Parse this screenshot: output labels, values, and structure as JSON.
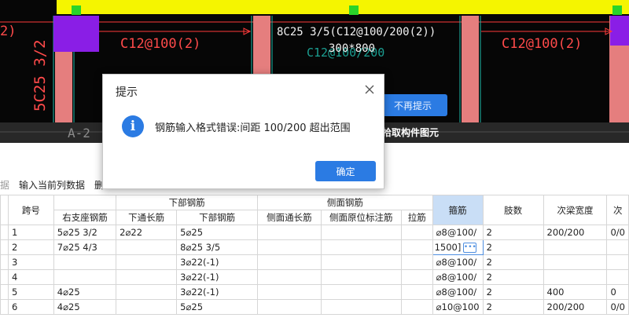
{
  "cad": {
    "beam_label_line1": "8C25 3/5(C12@100/200(2))",
    "beam_label_line2": "300*800",
    "stirrup_left": "C12@100(2)",
    "stirrup_right": "C12@100(2)",
    "stirrup_center_ghost": "C12@100/200",
    "left_edge_text": "2)",
    "vertical_rebar": "5C25 3/2",
    "axis_label": "A-2",
    "status_text": "拾取构件图元",
    "no_remind_button": "不再提示",
    "colors": {
      "beam_yellow": "#f5f500",
      "column_pink": "#e88080",
      "violet": "#8a1ee6",
      "grip_green": "#2ad42a"
    }
  },
  "toolbar": {
    "faded_item": "据",
    "input_column": "输入当前列数据",
    "delete_item": "删"
  },
  "dialog": {
    "title": "提示",
    "message": "钢筋输入格式错误:间距 100/200 超出范围",
    "ok_label": "确定",
    "info_icon": "info-icon",
    "close_icon": "close-icon"
  },
  "table": {
    "group_headers": {
      "span": "跨号",
      "bottom": "下部钢筋",
      "side": "侧面钢筋",
      "stirrup": "箍筋",
      "legs": "肢数",
      "secondary_width": "次梁宽度",
      "overflow": "次"
    },
    "sub_headers": {
      "right_support": "右支座钢筋",
      "bottom_through": "下通长筋",
      "bottom_rebar": "下部钢筋",
      "side_through": "侧面通长筋",
      "side_original": "侧面原位标注筋",
      "tie": "拉筋"
    },
    "rows": [
      {
        "span": "1",
        "right_support": "5⌀25 3/2",
        "bottom_through": "2⌀22",
        "bottom_rebar": "5⌀25",
        "side_through": "",
        "side_original": "",
        "tie": "",
        "stirrup": "⌀8@100/",
        "legs": "2",
        "secondary_width": "200/200",
        "overflow": "0/0"
      },
      {
        "span": "2",
        "right_support": "7⌀25 4/3",
        "bottom_through": "",
        "bottom_rebar": "8⌀25 3/5",
        "side_through": "",
        "side_original": "",
        "tie": "",
        "stirrup": "1500]",
        "legs": "2",
        "secondary_width": "",
        "overflow": ""
      },
      {
        "span": "3",
        "right_support": "",
        "bottom_through": "",
        "bottom_rebar": "3⌀22(-1)",
        "side_through": "",
        "side_original": "",
        "tie": "",
        "stirrup": "⌀8@100/",
        "legs": "2",
        "secondary_width": "",
        "overflow": ""
      },
      {
        "span": "4",
        "right_support": "",
        "bottom_through": "",
        "bottom_rebar": "3⌀22(-1)",
        "side_through": "",
        "side_original": "",
        "tie": "",
        "stirrup": "⌀8@100/",
        "legs": "2",
        "secondary_width": "",
        "overflow": ""
      },
      {
        "span": "5",
        "right_support": "4⌀25",
        "bottom_through": "",
        "bottom_rebar": "3⌀22(-1)",
        "side_through": "",
        "side_original": "",
        "tie": "",
        "stirrup": "⌀8@100/",
        "legs": "2",
        "secondary_width": "400",
        "overflow": "0"
      },
      {
        "span": "6",
        "right_support": "4⌀25",
        "bottom_through": "",
        "bottom_rebar": "5⌀25",
        "side_through": "",
        "side_original": "",
        "tie": "",
        "stirrup": "⌀10@100",
        "legs": "2",
        "secondary_width": "200/200",
        "overflow": "0/0"
      }
    ]
  }
}
